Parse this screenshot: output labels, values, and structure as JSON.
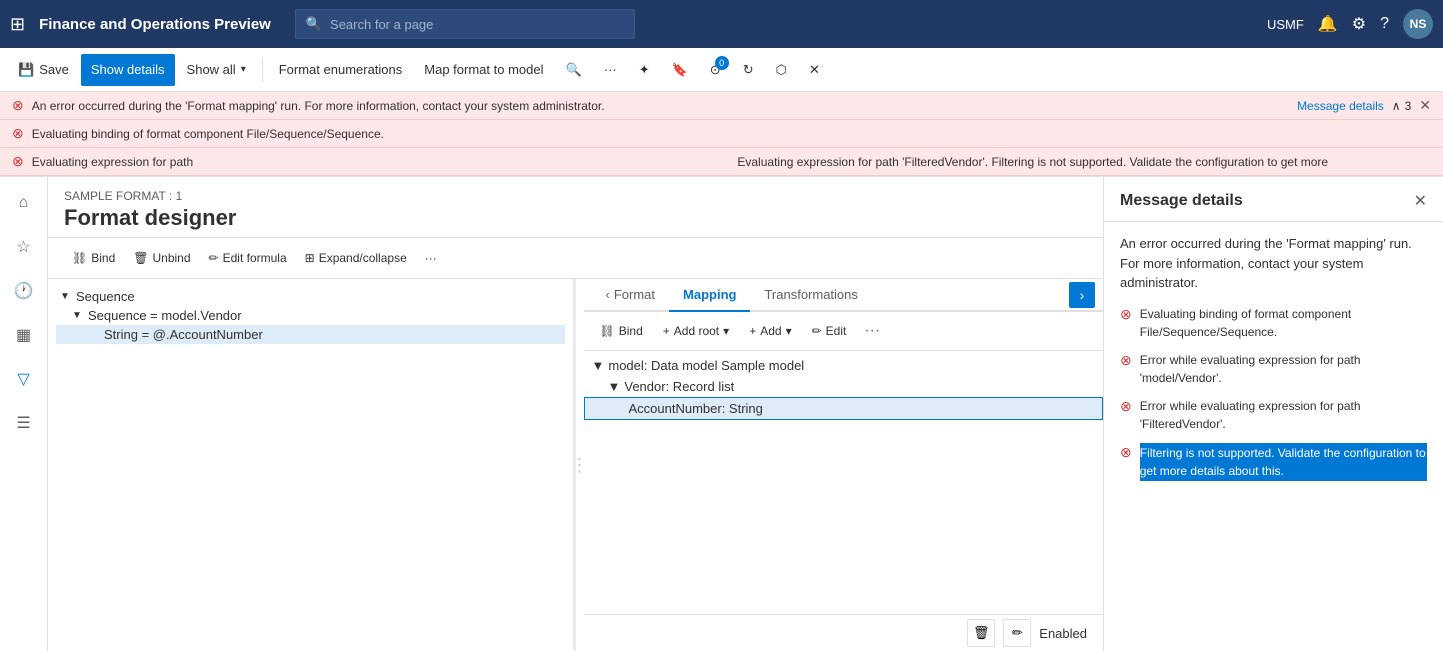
{
  "app": {
    "title": "Finance and Operations Preview"
  },
  "nav": {
    "search_placeholder": "Search for a page",
    "region": "USMF",
    "avatar_initials": "NS"
  },
  "toolbar": {
    "save_label": "Save",
    "show_details_label": "Show details",
    "show_all_label": "Show all",
    "format_enumerations_label": "Format enumerations",
    "map_format_label": "Map format to model"
  },
  "errors": {
    "error1_text": "An error occurred during the 'Format mapping' run. For more information, contact your system administrator.",
    "error1_link": "Message details",
    "counter": "3",
    "error2_text": "Evaluating binding of format component File/Sequence/Sequence.",
    "error3_prefix": "Evaluating expression for path",
    "error3_detail": "Evaluating expression for path 'FilteredVendor'. Filtering is not supported. Validate the configuration to get more"
  },
  "designer": {
    "sample_label": "SAMPLE FORMAT : 1",
    "title": "Format designer"
  },
  "designer_toolbar": {
    "bind_label": "Bind",
    "unbind_label": "Unbind",
    "edit_formula_label": "Edit formula",
    "expand_collapse_label": "Expand/collapse"
  },
  "left_tree": {
    "sequence_label": "Sequence",
    "sequence_model": "Sequence = model.Vendor",
    "string_account": "String = @.AccountNumber"
  },
  "tabs": {
    "format_label": "Format",
    "mapping_label": "Mapping",
    "transformations_label": "Transformations"
  },
  "right_toolbar": {
    "bind_label": "Bind",
    "add_root_label": "Add root",
    "add_label": "Add",
    "edit_label": "Edit"
  },
  "right_tree": {
    "model_label": "model: Data model Sample model",
    "vendor_label": "Vendor: Record list",
    "account_number_label": "AccountNumber: String"
  },
  "bottom": {
    "status_label": "Enabled"
  },
  "message_panel": {
    "title": "Message details",
    "intro": "An error occurred during the 'Format mapping' run. For more information, contact your system administrator.",
    "error1": "Evaluating binding of format component File/Sequence/Sequence.",
    "error2": "Error while evaluating expression for path 'model/Vendor'.",
    "error3": "Error while evaluating expression for path 'FilteredVendor'.",
    "error4_highlighted": "Filtering is not supported. Validate the configuration to get more details about this."
  }
}
